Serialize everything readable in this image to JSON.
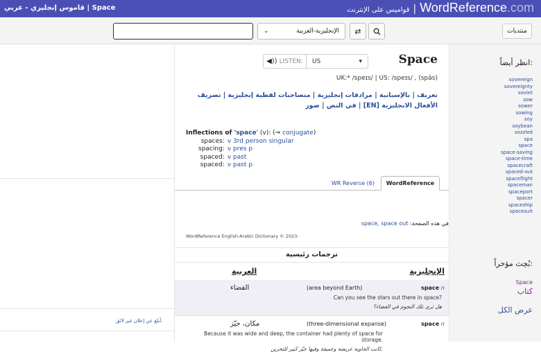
{
  "topbar": {
    "left_title": "قاموس إنجليزي - عربي | Space",
    "subtitle": "قواميس على الإنترنت",
    "separator": "|",
    "brand_main": "WordReference",
    "brand_tld": ".com"
  },
  "search": {
    "input_value": "",
    "dict_selected": "الإنجليزية-العربية",
    "forum_label": "منتديات"
  },
  "entry": {
    "listen_label": "LISTEN:",
    "accent": "US",
    "headword": "Space",
    "pronunciation": "UK:* /speɪs/  |  US:  /speɪs/ , (spās)",
    "links": "تعريف | بالإسبانية | مرادفات إنجليزية | متصاحبات لفظية إنجليزية | تصريف الأفعال الانجليزية [EN] | في النص | صور"
  },
  "inflections": {
    "prefix": "Inflections of '",
    "word": "space",
    "suffix": "' (v): (⇒",
    "conjugate": "conjugate",
    "close": ")",
    "rows": [
      {
        "form": "spaces:",
        "desc": "v 3rd person singular"
      },
      {
        "form": "spacing:",
        "desc": "v pres p"
      },
      {
        "form": "spaced:",
        "desc": "v past"
      },
      {
        "form": "spaced:",
        "desc": "v past p"
      }
    ]
  },
  "tabs": {
    "reverse": "WR Reverse (6)",
    "wordreference": "WordReference"
  },
  "onpage": {
    "label": "في هذه الصفحة:",
    "links": "space, space out"
  },
  "copyright": "WordReference English-Arabic Dictionary © 2023:",
  "table": {
    "section_title": "ترجمات رئيسية",
    "col_en": "الإنجليزية",
    "col_ar": "العربية",
    "rows": [
      {
        "term": "space",
        "pos": "n",
        "definition": "(area beyond Earth)",
        "translation": "الفضاء",
        "example_en": "Can you see the stars out there in space?",
        "example_ar": "هل ترى تلك النجوم في الفضاء؟"
      },
      {
        "term": "space",
        "pos": "n",
        "definition": "(three-dimensional expanse)",
        "translation": "مكان، حيّز",
        "example_en": "Because it was wide and deep, the container had plenty of space for storage.",
        "example_ar": "كانت الحاوية عريضة وعميقة وفيها حيّز كبير للتخزين."
      }
    ]
  },
  "left": {
    "report": "أبلغ عن إعلان غير لائق."
  },
  "sidebar": {
    "see_also_title": "انظر أيضاً:",
    "see_also": [
      "sovereign",
      "sovereignty",
      "soviet",
      "sow",
      "sower",
      "sowing",
      "soy",
      "soybean",
      "sozzled",
      "spa",
      "space",
      "space-saving",
      "space-time",
      "spacecraft",
      "spaced-out",
      "spaceflight",
      "spaceman",
      "spaceport",
      "spacer",
      "spaceship",
      "spacesuit"
    ],
    "recent_title": "بُحِث مؤخراً:",
    "recent": [
      "Space",
      "كتاب"
    ],
    "view_all": "عرض الكل"
  }
}
